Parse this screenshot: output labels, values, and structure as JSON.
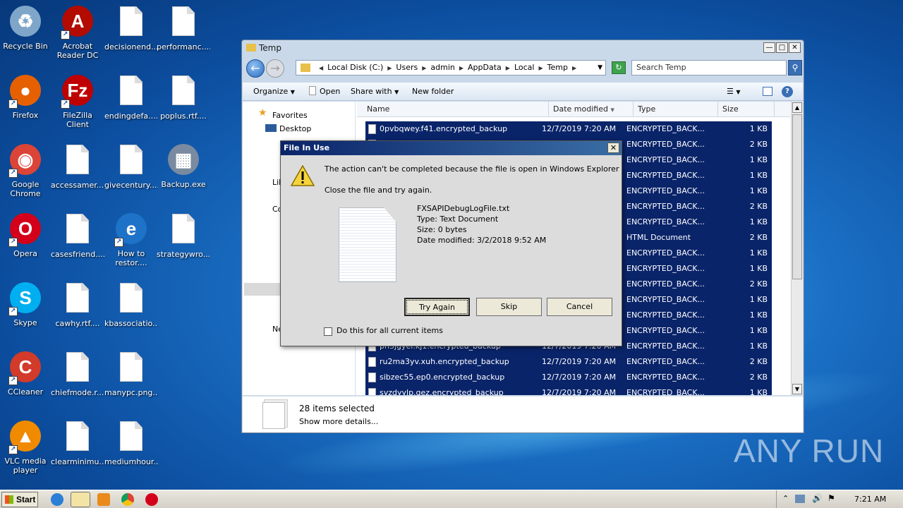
{
  "desktop": {
    "icons": [
      {
        "label": "Recycle Bin",
        "type": "recycle"
      },
      {
        "label": "Acrobat Reader DC",
        "type": "acrobat"
      },
      {
        "label": "decisionend....",
        "type": "file"
      },
      {
        "label": "performanc....",
        "type": "file"
      },
      {
        "label": "Firefox",
        "type": "firefox"
      },
      {
        "label": "FileZilla Client",
        "type": "filezilla"
      },
      {
        "label": "endingdefa....",
        "type": "file"
      },
      {
        "label": "poplus.rtf....",
        "type": "file"
      },
      {
        "label": "Google Chrome",
        "type": "chrome"
      },
      {
        "label": "accessamer....",
        "type": "file"
      },
      {
        "label": "givecentury....",
        "type": "file"
      },
      {
        "label": "Backup.exe",
        "type": "exe"
      },
      {
        "label": "Opera",
        "type": "opera"
      },
      {
        "label": "casesfriend....",
        "type": "file"
      },
      {
        "label": "How to restor....",
        "type": "ie"
      },
      {
        "label": "strategywro....",
        "type": "file"
      },
      {
        "label": "Skype",
        "type": "skype"
      },
      {
        "label": "cawhy.rtf....",
        "type": "file"
      },
      {
        "label": "kbassociatio....",
        "type": "file"
      },
      {
        "label": "CCleaner",
        "type": "ccleaner"
      },
      {
        "label": "chiefmode.r....",
        "type": "file"
      },
      {
        "label": "manypc.png....",
        "type": "file"
      },
      {
        "label": "VLC media player",
        "type": "vlc"
      },
      {
        "label": "clearminimu....",
        "type": "file"
      },
      {
        "label": "mediumhour....",
        "type": "file"
      }
    ]
  },
  "explorer": {
    "title": "Temp",
    "breadcrumb": [
      "Local Disk (C:)",
      "Users",
      "admin",
      "AppData",
      "Local",
      "Temp"
    ],
    "search_placeholder": "Search Temp",
    "toolbar": {
      "organize": "Organize",
      "open": "Open",
      "share_with": "Share with",
      "new_folder": "New folder"
    },
    "nav": {
      "favorites": "Favorites",
      "desktop": "Desktop",
      "libraries": "Lib",
      "computer": "Co",
      "network": "Ne"
    },
    "columns": {
      "name": "Name",
      "date": "Date modified",
      "type": "Type",
      "size": "Size"
    },
    "rows": [
      {
        "name": "0pvbqwey.f41.encrypted_backup",
        "date": "12/7/2019 7:20 AM",
        "type": "ENCRYPTED_BACK...",
        "size": "1 KB"
      },
      {
        "name": "",
        "date": "",
        "type": "ENCRYPTED_BACK...",
        "size": "2 KB"
      },
      {
        "name": "",
        "date": "",
        "type": "ENCRYPTED_BACK...",
        "size": "1 KB"
      },
      {
        "name": "",
        "date": "",
        "type": "ENCRYPTED_BACK...",
        "size": "1 KB"
      },
      {
        "name": "",
        "date": "",
        "type": "ENCRYPTED_BACK...",
        "size": "1 KB"
      },
      {
        "name": "",
        "date": "",
        "type": "ENCRYPTED_BACK...",
        "size": "2 KB"
      },
      {
        "name": "",
        "date": "",
        "type": "ENCRYPTED_BACK...",
        "size": "1 KB"
      },
      {
        "name": "",
        "date": "",
        "type": "HTML Document",
        "size": "2 KB"
      },
      {
        "name": "",
        "date": "",
        "type": "ENCRYPTED_BACK...",
        "size": "1 KB"
      },
      {
        "name": "",
        "date": "",
        "type": "ENCRYPTED_BACK...",
        "size": "1 KB"
      },
      {
        "name": "",
        "date": "",
        "type": "ENCRYPTED_BACK...",
        "size": "2 KB"
      },
      {
        "name": "",
        "date": "",
        "type": "ENCRYPTED_BACK...",
        "size": "1 KB"
      },
      {
        "name": "",
        "date": "",
        "type": "ENCRYPTED_BACK...",
        "size": "1 KB"
      },
      {
        "name": "",
        "date": "",
        "type": "ENCRYPTED_BACK...",
        "size": "1 KB"
      },
      {
        "name": "pn3jgyel.kj1.encrypted_backup",
        "date": "12/7/2019 7:20 AM",
        "type": "ENCRYPTED_BACK...",
        "size": "1 KB"
      },
      {
        "name": "ru2ma3yv.xuh.encrypted_backup",
        "date": "12/7/2019 7:20 AM",
        "type": "ENCRYPTED_BACK...",
        "size": "2 KB"
      },
      {
        "name": "sibzec55.ep0.encrypted_backup",
        "date": "12/7/2019 7:20 AM",
        "type": "ENCRYPTED_BACK...",
        "size": "2 KB"
      },
      {
        "name": "svzdyylp.qez.encrypted_backup",
        "date": "12/7/2019 7:20 AM",
        "type": "ENCRYPTED_BACK...",
        "size": "1 KB"
      }
    ],
    "details": {
      "count": "28 items selected",
      "more": "Show more details..."
    }
  },
  "dialog": {
    "title": "File In Use",
    "message": "The action can't be completed because the file is open in Windows Explorer",
    "hint": "Close the file and try again.",
    "file_name": "FXSAPIDebugLogFile.txt",
    "file_type": "Type: Text Document",
    "file_size": "Size: 0 bytes",
    "file_date": "Date modified: 3/2/2018 9:52 AM",
    "try_again": "Try Again",
    "skip": "Skip",
    "cancel": "Cancel",
    "checkbox_label": "Do this for all current items"
  },
  "taskbar": {
    "start": "Start",
    "clock": "7:21 AM"
  },
  "watermark": "ANY RUN",
  "colors": {
    "selection": "#0a246a",
    "dialog_title": "#0a246a"
  }
}
